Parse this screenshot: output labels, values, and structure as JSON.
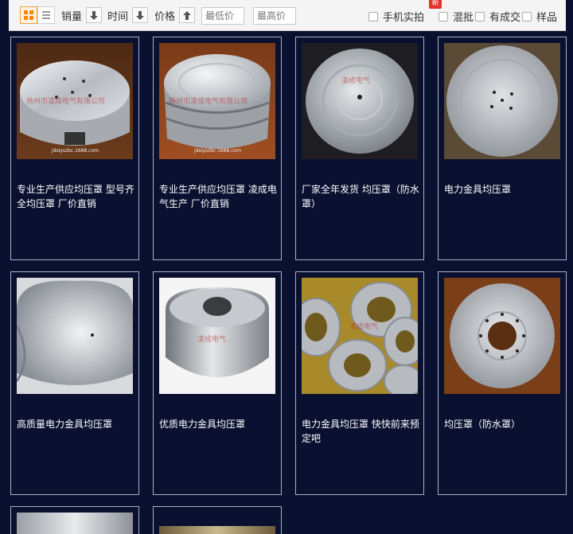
{
  "toolbar": {
    "sort_sales": "销量",
    "sort_time": "时间",
    "sort_price": "价格",
    "price_min_placeholder": "最低价",
    "price_max_placeholder": "最高价",
    "separator": "-",
    "filters": [
      "手机实拍",
      "混批",
      "有成交",
      "样品"
    ],
    "new_badge": "新"
  },
  "products": [
    {
      "title": "专业生产供应均压罩 型号齐全均压罩 厂价直销",
      "watermark": "扬州市凌成电气有限公司",
      "site": "jdslyszbc.1688.com"
    },
    {
      "title": "专业生产供应均压罩 凌成电气生产 厂价直销",
      "watermark": "扬州市凌成电气有限公司",
      "site": "jdslyszbc.1688.com"
    },
    {
      "title": "厂家全年发货 均压罩（防水罩）",
      "watermark": "凌成电气",
      "site": ""
    },
    {
      "title": "电力金具均压罩",
      "watermark": "",
      "site": ""
    },
    {
      "title": "高质量电力金具均压罩",
      "watermark": "",
      "site": ""
    },
    {
      "title": "优质电力金具均压罩",
      "watermark": "凌成电气",
      "site": ""
    },
    {
      "title": "电力金具均压罩 快快前来预定吧",
      "watermark": "凌成电气",
      "site": ""
    },
    {
      "title": "均压罩（防水罩）",
      "watermark": "",
      "site": ""
    }
  ],
  "colors": {
    "page_bg": "#0a1030",
    "accent": "#f08a00",
    "badge": "#e0322a"
  }
}
